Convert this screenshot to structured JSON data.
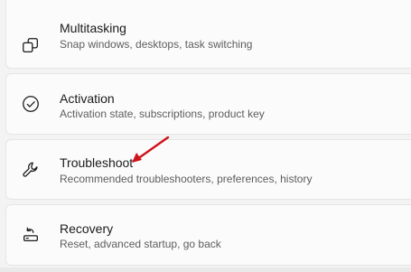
{
  "settings_items": [
    {
      "title": "Multitasking",
      "subtitle": "Snap windows, desktops, task switching",
      "icon": "multitasking-icon"
    },
    {
      "title": "Activation",
      "subtitle": "Activation state, subscriptions, product key",
      "icon": "checkmark-circle-icon"
    },
    {
      "title": "Troubleshoot",
      "subtitle": "Recommended troubleshooters, preferences, history",
      "icon": "wrench-icon"
    },
    {
      "title": "Recovery",
      "subtitle": "Reset, advanced startup, go back",
      "icon": "recovery-icon"
    }
  ],
  "annotation": {
    "arrow_color": "#d0121b",
    "points_to": "Troubleshoot"
  }
}
